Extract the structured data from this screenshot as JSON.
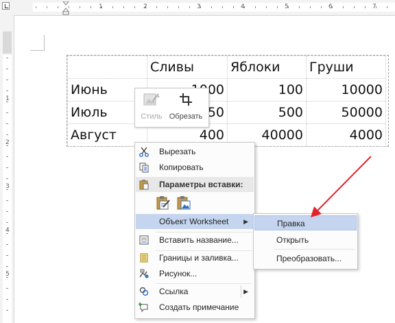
{
  "ruler": {
    "h_numbers": [
      "1",
      "2",
      "3",
      "4",
      "5",
      "6",
      "7"
    ],
    "v_numbers": [
      "1",
      "1",
      "2",
      "3",
      "4",
      "5"
    ]
  },
  "table": {
    "header": [
      "",
      "Сливы",
      "Яблоки",
      "Груши"
    ],
    "rows": [
      [
        "Июнь",
        "1000",
        "100",
        "10000"
      ],
      [
        "Июль",
        "50",
        "500",
        "50000"
      ],
      [
        "Август",
        "400",
        "40000",
        "4000"
      ]
    ]
  },
  "mini_toolbar": {
    "style_label": "Стиль",
    "crop_label": "Обрезать"
  },
  "context_menu": {
    "cut": "Вырезать",
    "copy": "Копировать",
    "paste_header": "Параметры вставки:",
    "worksheet_object": "Объект Worksheet",
    "insert_caption": "Вставить название...",
    "borders": "Границы и заливка...",
    "picture": "Рисунок...",
    "link": "Ссылка",
    "comment": "Создать примечание"
  },
  "submenu": {
    "edit": "Правка",
    "open": "Открыть",
    "convert": "Преобразовать..."
  },
  "colors": {
    "highlight": "#c5d5f0",
    "arrow": "#e0242a",
    "accent_blue": "#2f6fc1"
  }
}
